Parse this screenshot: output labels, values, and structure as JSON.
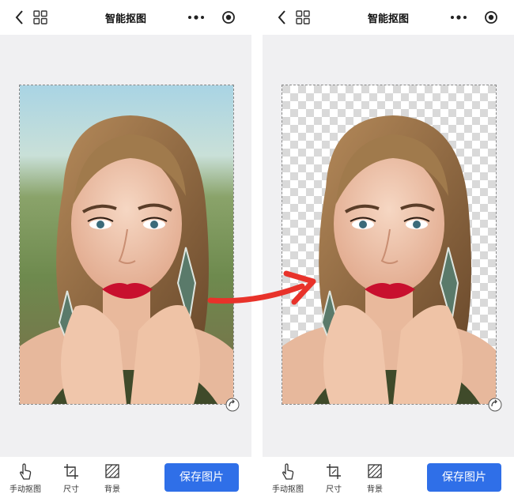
{
  "screens": [
    {
      "title": "智能抠图",
      "tools": [
        {
          "label": "手动抠图",
          "icon": "hand-pointer-icon"
        },
        {
          "label": "尺寸",
          "icon": "crop-icon"
        },
        {
          "label": "背景",
          "icon": "hatched-background-icon"
        }
      ],
      "save_label": "保存图片",
      "image_state": "original-with-background"
    },
    {
      "title": "智能抠图",
      "tools": [
        {
          "label": "手动抠图",
          "icon": "hand-pointer-icon"
        },
        {
          "label": "尺寸",
          "icon": "crop-icon"
        },
        {
          "label": "背景",
          "icon": "hatched-background-icon"
        }
      ],
      "save_label": "保存图片",
      "image_state": "background-removed-transparent"
    }
  ],
  "icons": [
    "back-chevron-icon",
    "grid-icon",
    "more-dots-icon",
    "target-icon",
    "rotate-icon",
    "red-arrow-icon"
  ],
  "colors": {
    "accent": "#2f6fe8",
    "arrow": "#e8322a",
    "lips": "#c8102e",
    "sky": "#a9d4e4",
    "foliage": "#6e8a4e"
  }
}
